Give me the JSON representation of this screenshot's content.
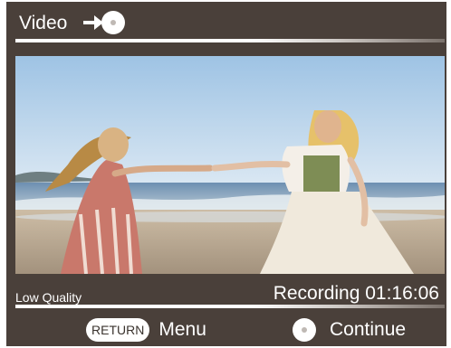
{
  "header": {
    "title": "Video",
    "icon": "disc-play-icon"
  },
  "status": {
    "quality": "Low Quality",
    "recording": "Recording 01:16:06"
  },
  "footer": {
    "return_button": "RETURN",
    "return_action": "Menu",
    "continue_icon": "disc-button-icon",
    "continue_action": "Continue"
  },
  "colors": {
    "frame": "#4a403a",
    "text": "#ffffff"
  }
}
